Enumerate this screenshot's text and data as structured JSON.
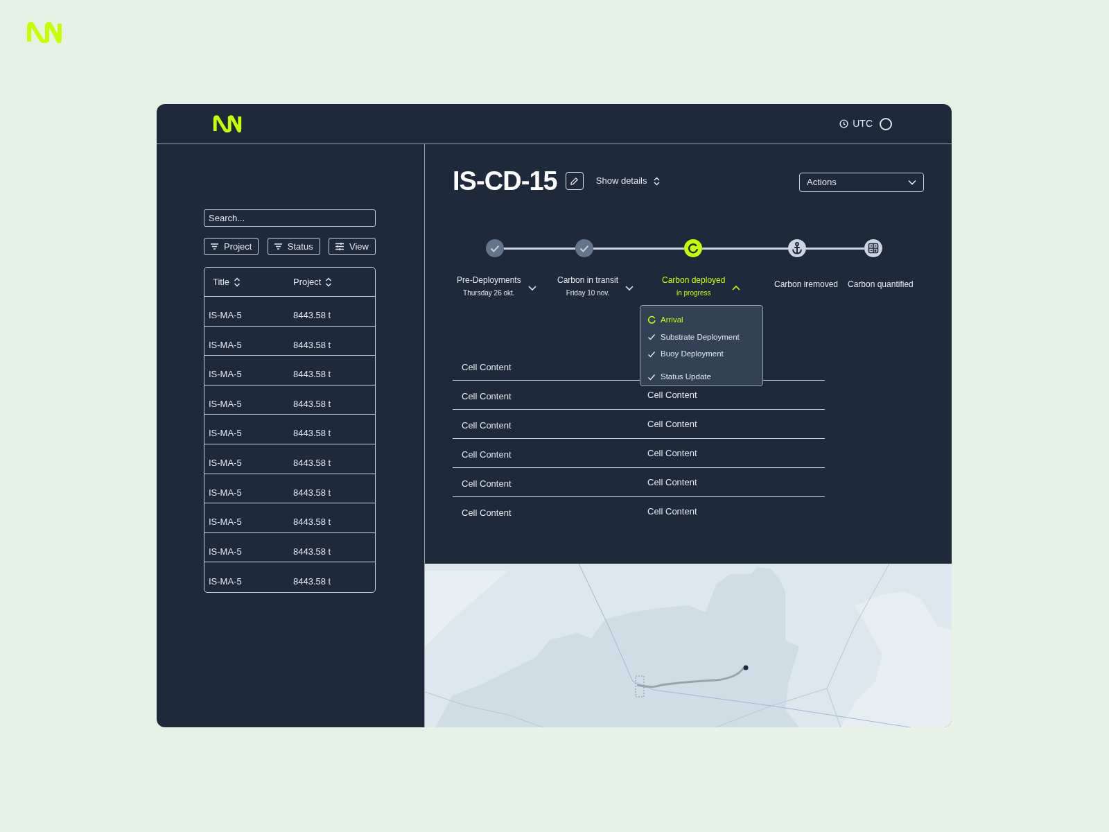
{
  "header": {
    "timezone": "UTC"
  },
  "sidebar": {
    "search": {
      "placeholder": "Search..."
    },
    "filters": [
      {
        "kind": "filter",
        "label": "Project"
      },
      {
        "kind": "filter",
        "label": "Status"
      },
      {
        "kind": "view",
        "label": "View"
      }
    ],
    "table": {
      "columns": [
        "Title",
        "Project"
      ],
      "rows": [
        [
          "IS-MA-5",
          "8443.58 t"
        ],
        [
          "IS-MA-5",
          "8443.58 t"
        ],
        [
          "IS-MA-5",
          "8443.58 t"
        ],
        [
          "IS-MA-5",
          "8443.58 t"
        ],
        [
          "IS-MA-5",
          "8443.58 t"
        ],
        [
          "IS-MA-5",
          "8443.58 t"
        ],
        [
          "IS-MA-5",
          "8443.58 t"
        ],
        [
          "IS-MA-5",
          "8443.58 t"
        ],
        [
          "IS-MA-5",
          "8443.58 t"
        ],
        [
          "IS-MA-5",
          "8443.58 t"
        ]
      ]
    }
  },
  "detail": {
    "title": "IS-CD-15",
    "details_toggle": "Show details",
    "actions": "Actions",
    "steps": [
      {
        "label": "Pre-Deployments",
        "sub": "Thursday 26 okt.",
        "kind": "check",
        "completed": true,
        "current": false,
        "menu": {
          "expanded": false
        }
      },
      {
        "label": "Carbon in transit",
        "sub": "Friday 10 nov.",
        "kind": "check",
        "completed": true,
        "current": false,
        "menu": {
          "expanded": false
        }
      },
      {
        "label": "Carbon deployed",
        "sub": "in progress",
        "kind": "progress",
        "completed": false,
        "current": true,
        "menu": {
          "expanded": true
        }
      },
      {
        "label": "Carbon iremoved",
        "kind": "anchor",
        "completed": false,
        "current": false
      },
      {
        "label": "Carbon quantified",
        "kind": "calculator",
        "completed": false,
        "current": false
      }
    ],
    "substeps": [
      {
        "label": "Arrival",
        "completed": false
      },
      {
        "label": "Substrate Deployment",
        "completed": true
      },
      {
        "label": "Buoy Deployment",
        "completed": true
      },
      {
        "label": "Status Update",
        "completed": true
      }
    ],
    "table": {
      "rows": [
        [
          "Cell Content"
        ],
        [
          "Cell Content",
          "Cell Content"
        ],
        [
          "Cell Content",
          "Cell Content"
        ],
        [
          "Cell Content",
          "Cell Content"
        ],
        [
          "Cell Content",
          "Cell Content"
        ],
        [
          "Cell Content",
          "Cell Content"
        ]
      ]
    }
  }
}
